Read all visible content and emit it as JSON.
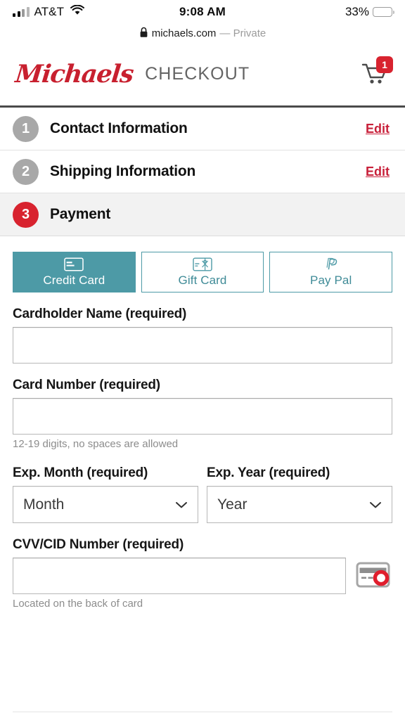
{
  "status_bar": {
    "carrier": "AT&T",
    "wifi_icon": "wifi-icon",
    "signal_icon": "cellular-signal-icon",
    "time": "9:08 AM",
    "battery_percent": "33%",
    "battery_level": 33
  },
  "browser": {
    "lock_icon": "lock-icon",
    "host": "michaels.com",
    "private_label": "— Private"
  },
  "header": {
    "logo_text": "Michaels",
    "page_title": "CHECKOUT",
    "cart_icon": "shopping-cart-icon",
    "cart_count": "1"
  },
  "steps": [
    {
      "number": "1",
      "label": "Contact Information",
      "edit_label": "Edit",
      "active": false
    },
    {
      "number": "2",
      "label": "Shipping Information",
      "edit_label": "Edit",
      "active": false
    },
    {
      "number": "3",
      "label": "Payment",
      "edit_label": "",
      "active": true
    }
  ],
  "payment": {
    "methods": [
      {
        "label": "Credit Card",
        "icon": "credit-card-icon",
        "selected": true
      },
      {
        "label": "Gift Card",
        "icon": "gift-card-icon",
        "selected": false
      },
      {
        "label": "Pay Pal",
        "icon": "paypal-icon",
        "selected": false
      }
    ],
    "cardholder": {
      "label": "Cardholder Name (required)",
      "value": "",
      "placeholder": ""
    },
    "card_number": {
      "label": "Card Number (required)",
      "value": "",
      "placeholder": "",
      "hint": "12-19 digits, no spaces are allowed"
    },
    "exp_month": {
      "label": "Exp. Month (required)",
      "selected": "Month",
      "chevron_icon": "chevron-down-icon"
    },
    "exp_year": {
      "label": "Exp. Year (required)",
      "selected": "Year",
      "chevron_icon": "chevron-down-icon"
    },
    "cvv": {
      "label": "CVV/CID Number (required)",
      "value": "",
      "placeholder": "",
      "hint": "Located on the back of card",
      "help_icon": "card-back-cvv-icon"
    }
  },
  "colors": {
    "brand_red": "#c8202f",
    "step_red": "#d8232f",
    "teal": "#4d9aa6",
    "edit_link": "#c8203a",
    "active_row_bg": "#f2f2f2"
  }
}
